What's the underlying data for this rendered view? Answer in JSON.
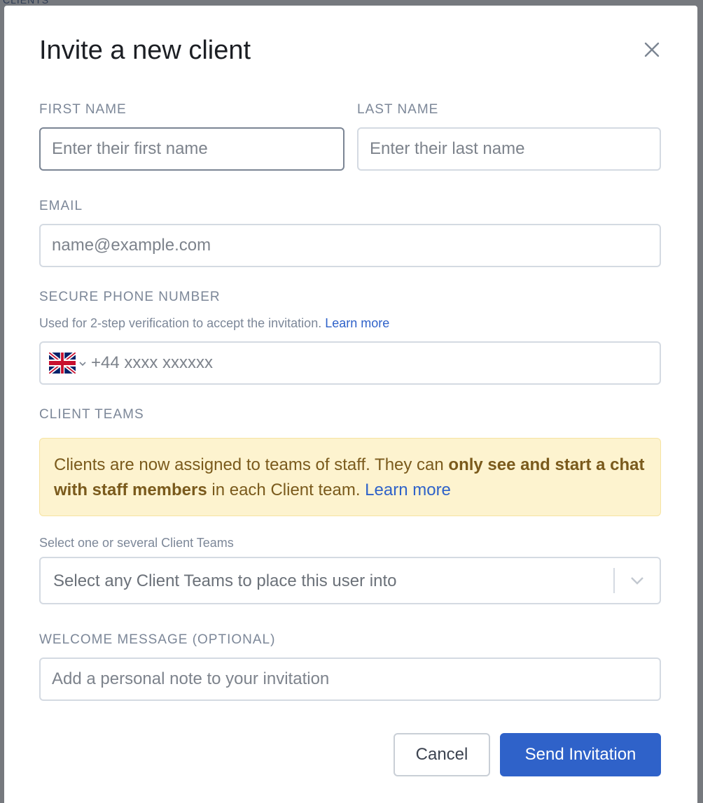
{
  "background": {
    "peek_text": "CLIENTS"
  },
  "dialog": {
    "title": "Invite a new client",
    "close_icon": "close-icon"
  },
  "form": {
    "first_name": {
      "label": "FIRST NAME",
      "placeholder": "Enter their first name",
      "value": ""
    },
    "last_name": {
      "label": "LAST NAME",
      "placeholder": "Enter their last name",
      "value": ""
    },
    "email": {
      "label": "EMAIL",
      "placeholder": "name@example.com",
      "value": ""
    },
    "phone": {
      "label": "SECURE PHONE NUMBER",
      "hint": "Used for 2-step verification to accept the invitation.",
      "hint_link": "Learn more",
      "country_icon": "uk-flag-icon",
      "placeholder": "+44 xxxx xxxxxx",
      "value": ""
    },
    "teams": {
      "label": "CLIENT TEAMS",
      "notice_prefix": "Clients are now assigned to teams of staff. They can",
      "notice_bold": "only see and start a chat with staff members",
      "notice_suffix": "in each Client team.",
      "notice_link": "Learn more",
      "select_label": "Select one or several Client Teams",
      "select_placeholder": "Select any Client Teams to place this user into"
    },
    "welcome": {
      "label": "WELCOME MESSAGE (OPTIONAL)",
      "placeholder": "Add a personal note to your invitation",
      "value": ""
    }
  },
  "actions": {
    "cancel_label": "Cancel",
    "send_label": "Send Invitation"
  },
  "colors": {
    "primary": "#2f62c9",
    "notice_bg": "#fdf3cf",
    "notice_text": "#7a5a1c",
    "label": "#7c8798"
  }
}
